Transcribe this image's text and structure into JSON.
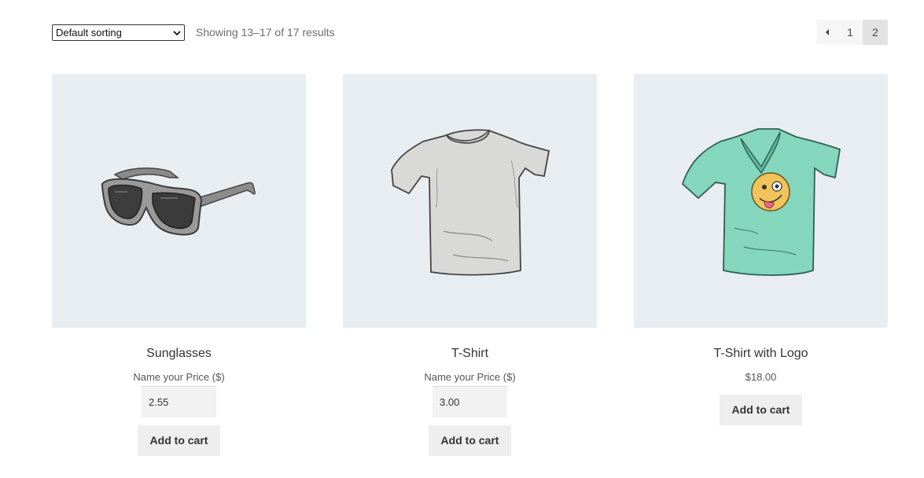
{
  "toolbar": {
    "sort_selected": "Default sorting",
    "result_count": "Showing 13–17 of 17 results"
  },
  "pagination": {
    "pages": [
      "1",
      "2"
    ],
    "current": "2"
  },
  "products": [
    {
      "title": "Sunglasses",
      "price_label": "Name your Price ($)",
      "price_value": "2.55",
      "button_label": "Add to cart",
      "image": "sunglasses-illustration"
    },
    {
      "title": "T-Shirt",
      "price_label": "Name your Price ($)",
      "price_value": "3.00",
      "button_label": "Add to cart",
      "image": "grey-tshirt-illustration"
    },
    {
      "title": "T-Shirt with Logo",
      "price": "$18.00",
      "button_label": "Add to cart",
      "image": "green-tshirt-with-logo-illustration"
    }
  ],
  "colors": {
    "image_bg": "#e8edf1",
    "button_bg": "#eeeeee",
    "tshirt_grey": "#d9d9d7",
    "tshirt_green": "#84d6bd",
    "logo_yellow": "#f2c35b"
  }
}
